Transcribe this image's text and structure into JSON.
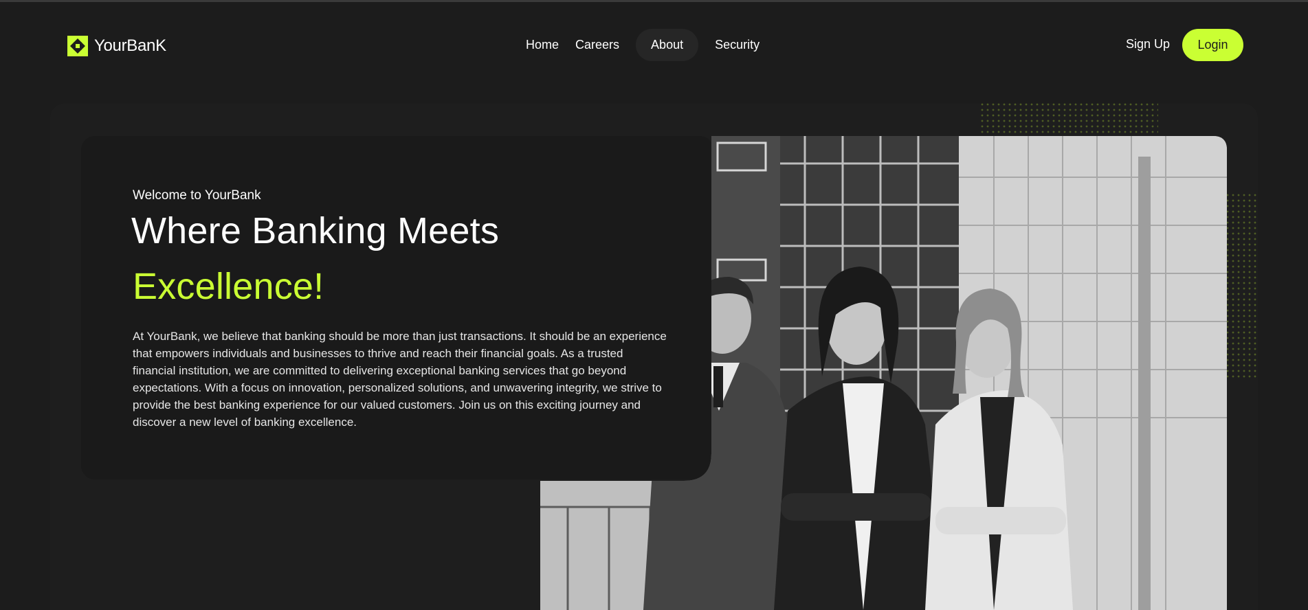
{
  "brand": {
    "name": "YourBanK",
    "accent_color": "#caff33",
    "logo_icon": "diamond-grid-logo-icon"
  },
  "nav": {
    "items": [
      {
        "label": "Home",
        "active": false
      },
      {
        "label": "Careers",
        "active": false
      },
      {
        "label": "About",
        "active": true
      },
      {
        "label": "Security",
        "active": false
      }
    ]
  },
  "auth": {
    "signup_label": "Sign Up",
    "login_label": "Login"
  },
  "hero": {
    "welcome": "Welcome to YourBank",
    "headline_line1": "Where Banking Meets",
    "headline_line2": "Excellence!",
    "paragraph": "At YourBank, we believe that banking should be more than just transactions. It should be an experience that empowers individuals and businesses to thrive and reach their financial goals. As a trusted financial institution, we are committed to delivering exceptional banking services that go beyond expectations. With a focus on innovation, personalized solutions, and unwavering integrity, we strive to provide the best banking experience for our valued customers. Join us on this exciting journey and discover a new level of banking excellence.",
    "image_icon": "team-photo-icon"
  },
  "colors": {
    "background": "#1c1c1c",
    "card": "#1a1a1a",
    "accent": "#caff33"
  }
}
